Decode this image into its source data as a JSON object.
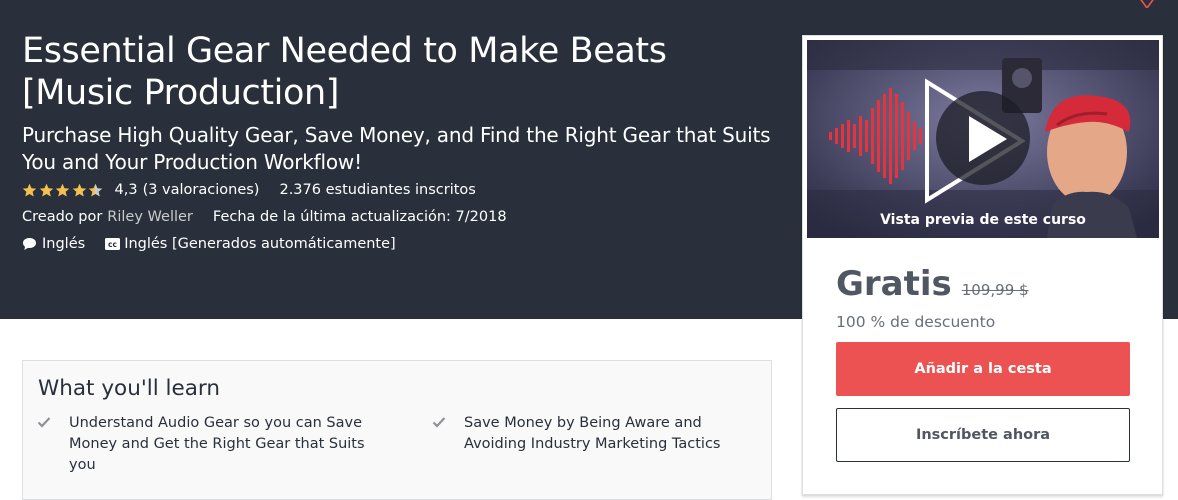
{
  "course": {
    "title": "Essential Gear Needed to Make Beats [Music Production]",
    "subtitle": "Purchase High Quality Gear, Save Money, and Find the Right Gear that Suits You and Your Production Workflow!",
    "rating": "4,3",
    "rating_count": "(3 valoraciones)",
    "stars": 4.3,
    "students": "2.376 estudiantes inscritos",
    "created_by_label": "Creado por",
    "author": "Riley Weller",
    "updated": "Fecha de la última actualización: 7/2018",
    "language": "Inglés",
    "captions": "Inglés [Generados automáticamente]"
  },
  "sidebar": {
    "preview_caption": "Vista previa de este curso",
    "price": "Gratis",
    "original_price": "109,99 $",
    "discount": "100 % de descuento",
    "add_to_cart": "Añadir a la cesta",
    "enroll_now": "Inscríbete ahora"
  },
  "learn": {
    "title": "What you'll learn",
    "items": [
      "Understand Audio Gear so you can Save Money and Get the Right Gear that Suits you",
      "Save Money by Being Aware and Avoiding Industry Marketing Tactics"
    ]
  },
  "icons": {
    "star": "star-icon",
    "speech": "speech-bubble-icon",
    "cc": "closed-captions-icon",
    "play": "play-icon",
    "check": "check-icon",
    "heart": "heart-icon"
  },
  "colors": {
    "hero_bg": "#29303b",
    "star": "#f4c150",
    "primary_button": "#ec5252"
  }
}
